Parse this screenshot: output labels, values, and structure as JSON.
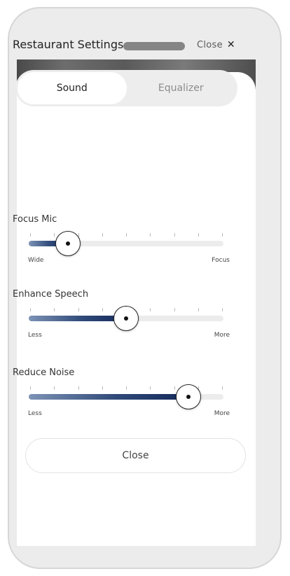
{
  "sheet": {
    "title": "Restaurant Settings",
    "close_label": "Close",
    "close_icon": "close-icon"
  },
  "tabs": [
    {
      "label": "Sound",
      "active": true
    },
    {
      "label": "Equalizer",
      "active": false
    }
  ],
  "sliders": [
    {
      "label": "Focus Mic",
      "min_label": "Wide",
      "max_label": "Focus",
      "value": 0.2
    },
    {
      "label": "Enhance Speech",
      "min_label": "Less",
      "max_label": "More",
      "value": 0.5
    },
    {
      "label": "Reduce Noise",
      "min_label": "Less",
      "max_label": "More",
      "value": 0.82
    }
  ],
  "footer": {
    "close_label": "Close"
  },
  "colors": {
    "slider_fill_start": "#7d93b6",
    "slider_fill_end": "#14295a",
    "track": "#ececec"
  }
}
